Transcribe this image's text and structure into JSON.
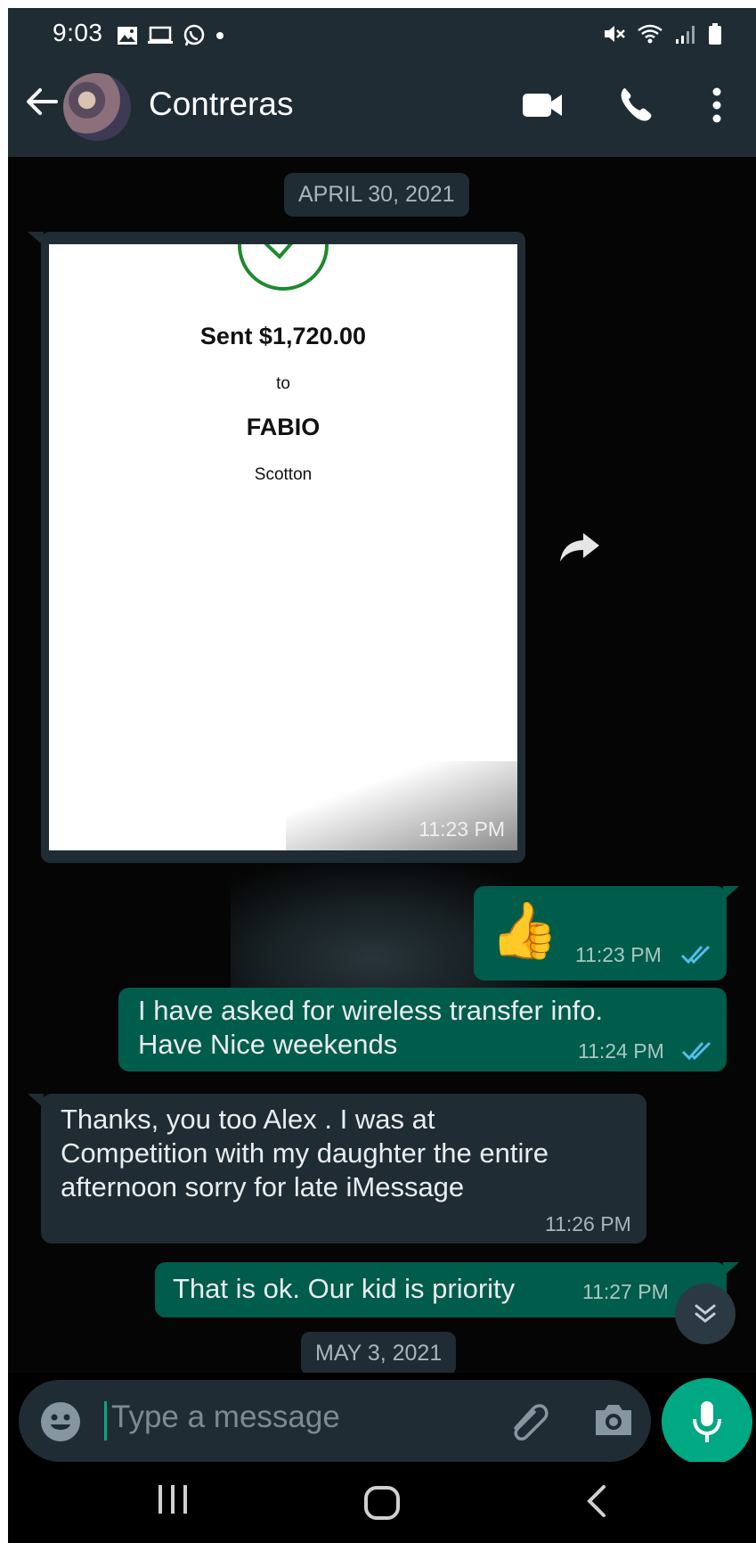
{
  "status_bar": {
    "time": "9:03",
    "left_icons": [
      "image-icon",
      "laptop-icon",
      "whatsapp-icon",
      "dot-icon"
    ],
    "right_icons": [
      "mute-icon",
      "wifi-icon",
      "signal-icon",
      "battery-icon"
    ]
  },
  "header": {
    "back_icon": "arrow-left-icon",
    "contact_name": "Contreras",
    "actions": [
      "video-call-icon",
      "phone-call-icon",
      "more-vert-icon"
    ]
  },
  "chat": {
    "date_chip_1": "APRIL 30, 2021",
    "payment_card": {
      "amount_line": "Sent $1,720.00",
      "to": "to",
      "recipient": "FABIO",
      "subtitle": "Scotton",
      "time": "11:23 PM"
    },
    "messages": [
      {
        "direction": "out",
        "text": "👍",
        "time": "11:23 PM",
        "status": "read"
      },
      {
        "direction": "out",
        "line1": "I have asked for wireless transfer info.",
        "line2": "Have Nice weekends",
        "time": "11:24 PM",
        "status": "read"
      },
      {
        "direction": "in",
        "line1": "Thanks, you too Alex . I was at",
        "line2": "Competition with my daughter the entire",
        "line3": "afternoon sorry for late iMessage",
        "time": "11:26 PM"
      },
      {
        "direction": "out",
        "text": "That is ok. Our kid is priority",
        "time": "11:27 PM"
      }
    ],
    "date_chip_2": "MAY 3, 2021"
  },
  "composer": {
    "placeholder": "Type a message",
    "icons": [
      "emoji-icon",
      "attach-icon",
      "camera-icon",
      "mic-icon"
    ]
  },
  "colors": {
    "header_bg": "#1f2c34",
    "incoming_bubble": "#1f2c34",
    "outgoing_bubble": "#005c4b",
    "accent": "#00a884",
    "read_ticks": "#53bdeb"
  }
}
